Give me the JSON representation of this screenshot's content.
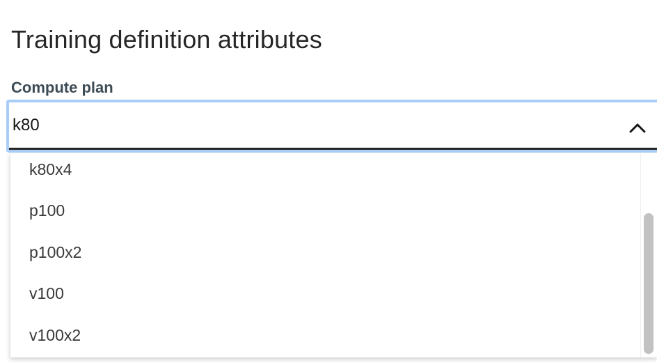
{
  "section": {
    "title": "Training definition attributes"
  },
  "compute_plan": {
    "label": "Compute plan",
    "value": "k80",
    "options": [
      "k80x4",
      "p100",
      "p100x2",
      "v100",
      "v100x2"
    ]
  },
  "icons": {
    "toggle": "chevron-up-icon"
  }
}
